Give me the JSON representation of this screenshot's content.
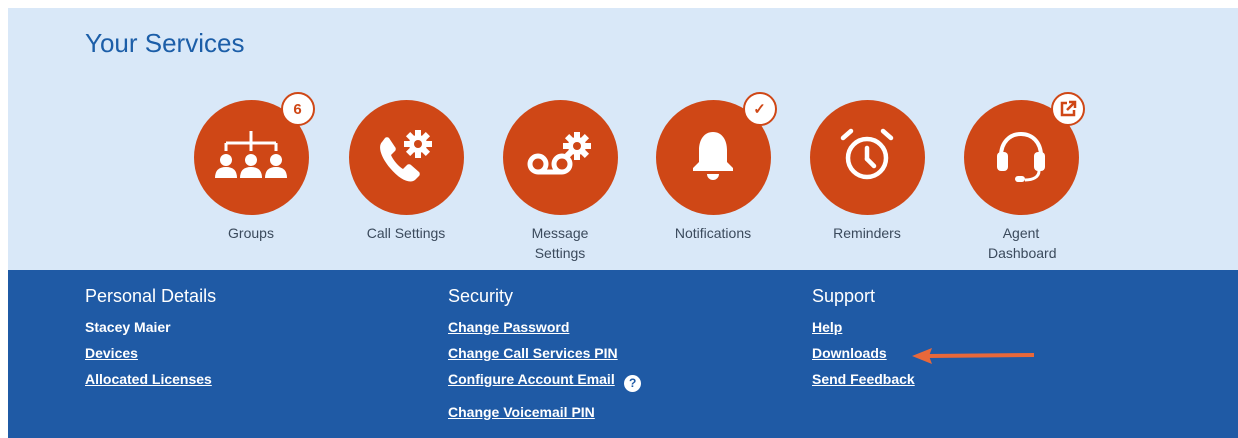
{
  "services": {
    "title": "Your Services",
    "items": [
      {
        "label": "Groups",
        "icon": "groups-icon",
        "badge": "6"
      },
      {
        "label": "Call Settings",
        "icon": "call-settings-icon",
        "badge": ""
      },
      {
        "label": "Message Settings",
        "icon": "voicemail-settings-icon",
        "badge": ""
      },
      {
        "label": "Notifications",
        "icon": "bell-icon",
        "badge": "✓"
      },
      {
        "label": "Reminders",
        "icon": "alarm-clock-icon",
        "badge": ""
      },
      {
        "label": "Agent Dashboard",
        "icon": "headset-icon",
        "badge": "external-link"
      }
    ]
  },
  "footer": {
    "personal": {
      "heading": "Personal Details",
      "name": "Stacey Maier",
      "links": [
        "Devices",
        "Allocated Licenses"
      ]
    },
    "security": {
      "heading": "Security",
      "links": [
        "Change Password",
        "Change Call Services PIN",
        "Configure Account Email",
        "Change Voicemail PIN"
      ]
    },
    "support": {
      "heading": "Support",
      "links": [
        "Help",
        "Downloads",
        "Send Feedback"
      ]
    }
  },
  "colors": {
    "services_bg": "#d9e8f8",
    "accent": "#cf4716",
    "footer_bg": "#1f5aa5",
    "title": "#1c5ea8",
    "annotation_arrow": "#e8683a"
  }
}
